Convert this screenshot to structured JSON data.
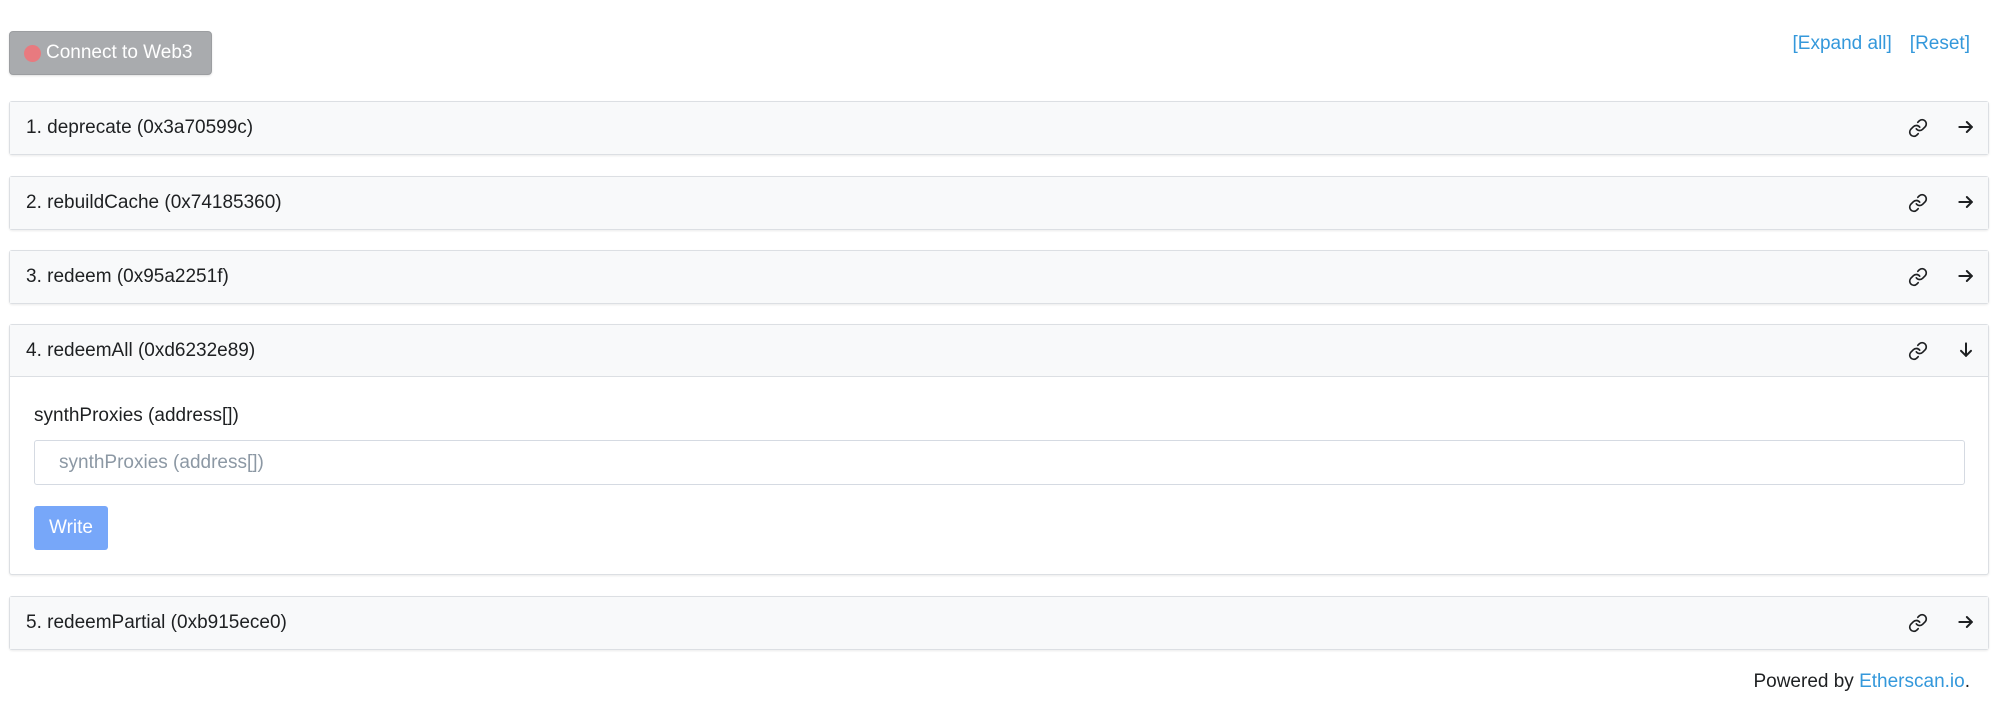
{
  "toolbar": {
    "connect_label": "Connect to Web3",
    "expand_all_label": "[Expand all]",
    "reset_label": "[Reset]"
  },
  "functions": [
    {
      "label": "1. deprecate (0x3a70599c)",
      "expanded": false
    },
    {
      "label": "2. rebuildCache (0x74185360)",
      "expanded": false
    },
    {
      "label": "3. redeem (0x95a2251f)",
      "expanded": false
    },
    {
      "label": "4. redeemAll (0xd6232e89)",
      "expanded": true,
      "param_label": "synthProxies (address[])",
      "param_placeholder": "synthProxies (address[])",
      "param_value": "",
      "write_label": "Write"
    },
    {
      "label": "5. redeemPartial (0xb915ece0)",
      "expanded": false
    }
  ],
  "footer": {
    "prefix": "Powered by ",
    "link_text": "Etherscan.io",
    "suffix": "."
  },
  "colors": {
    "accent_link": "#3498db",
    "write_button": "#77a7f9",
    "connect_button": "#a9abae",
    "status_dot": "#e87a7f"
  },
  "icons": {
    "status": "status-dot-icon",
    "link": "link-icon",
    "collapsed_arrow": "arrow-right-icon",
    "expanded_arrow": "arrow-down-icon"
  }
}
